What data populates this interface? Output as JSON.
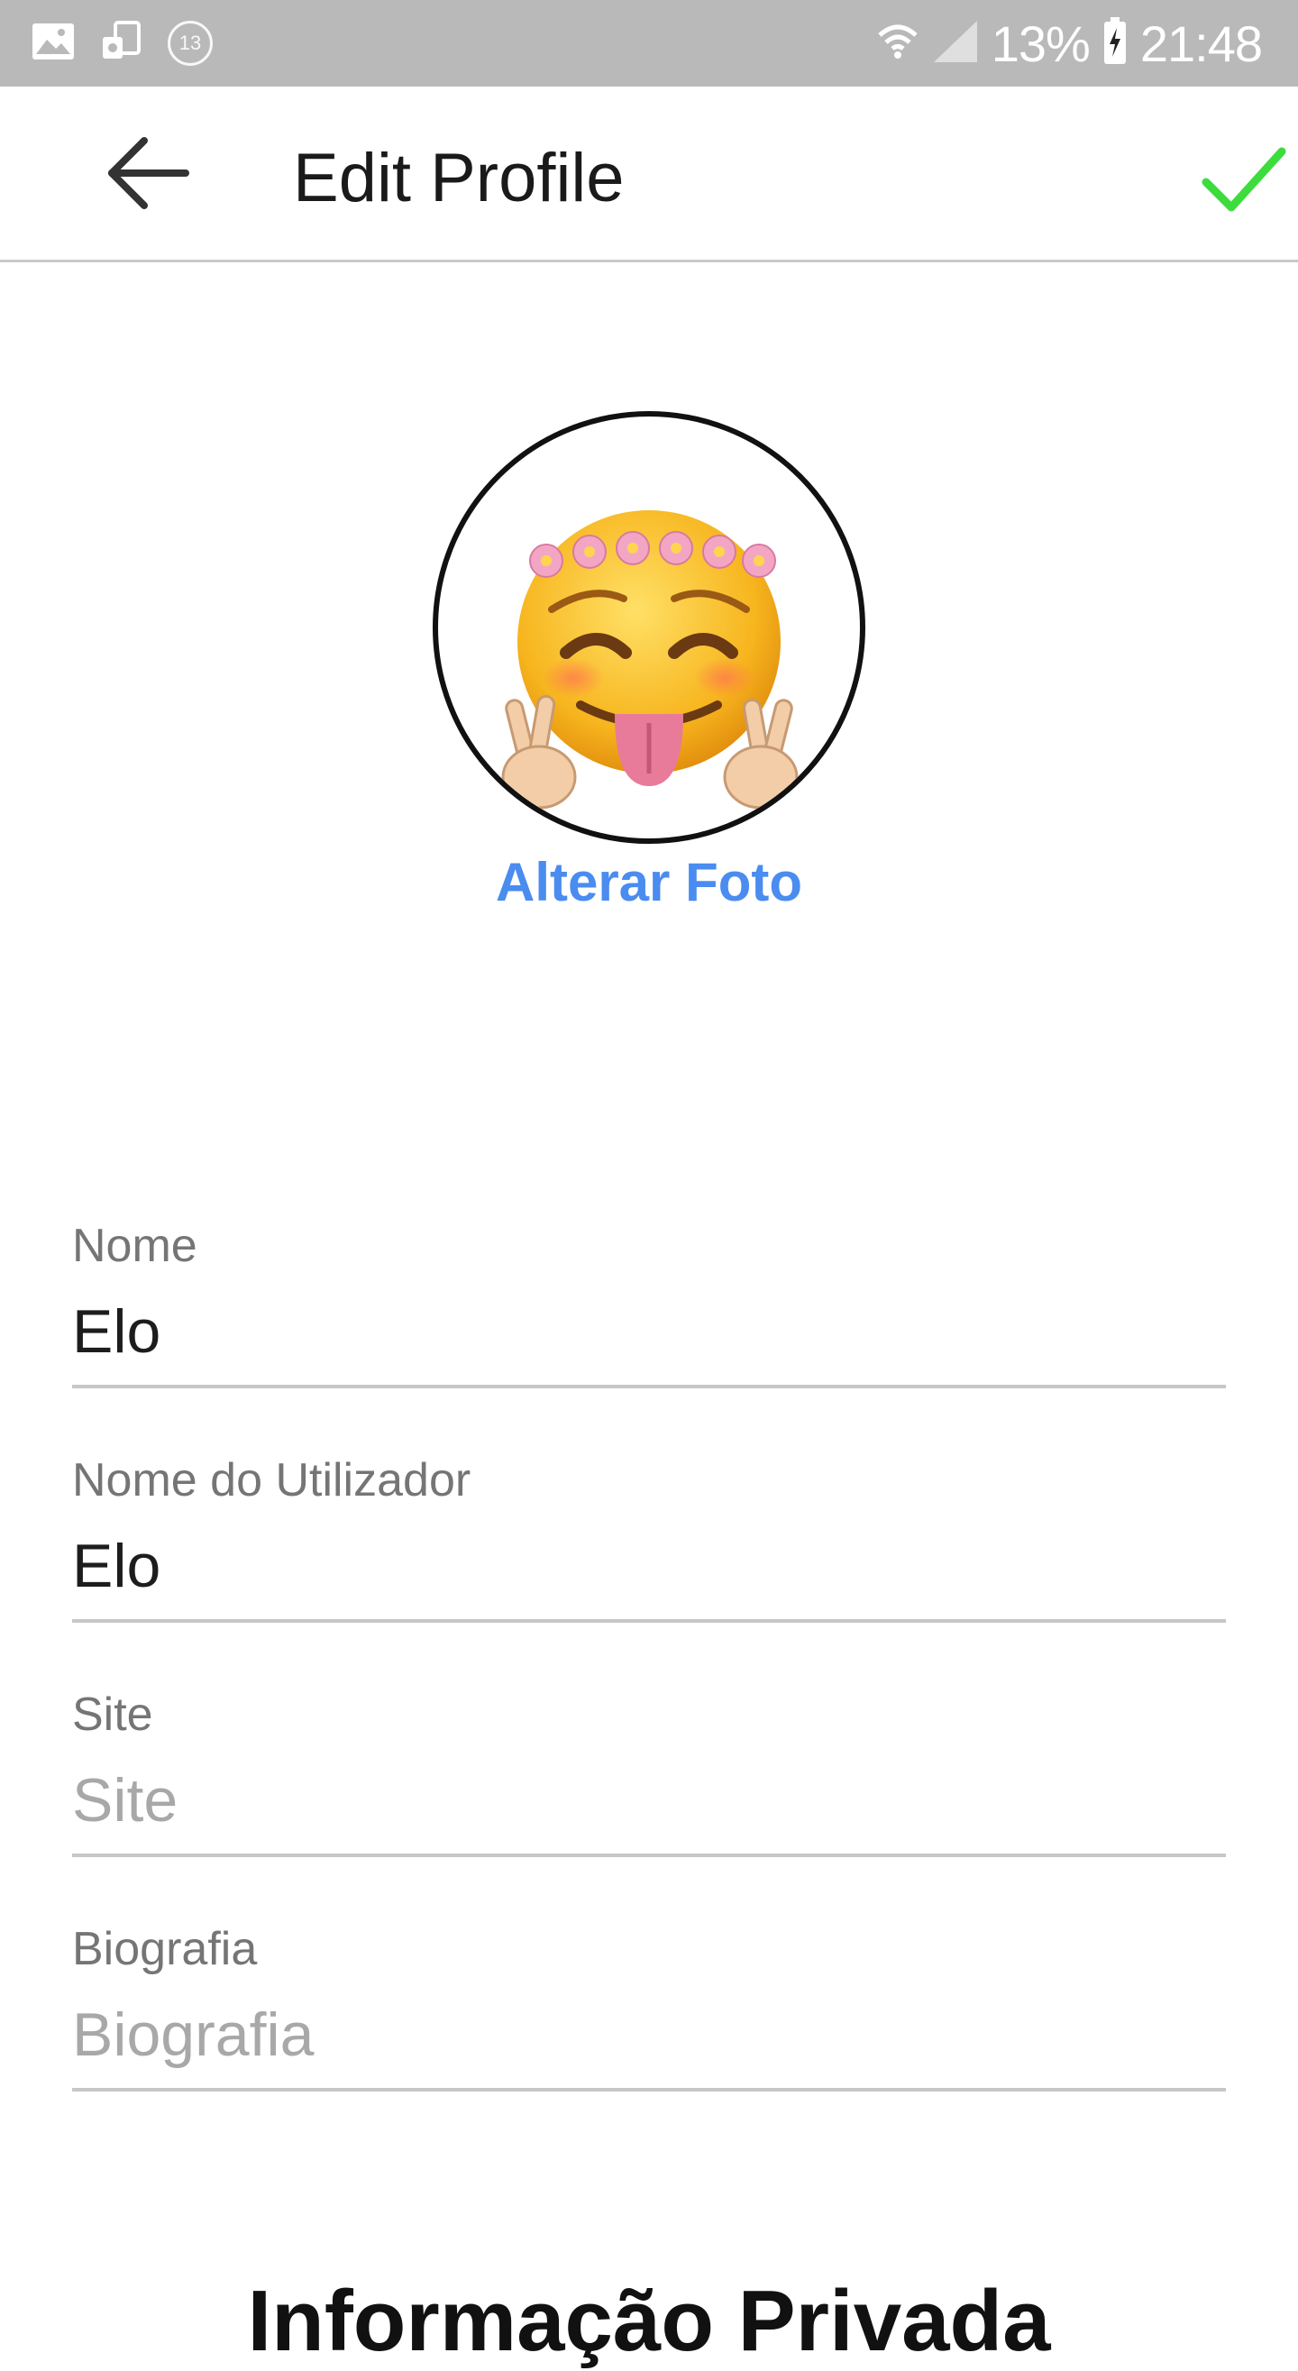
{
  "status_bar": {
    "notification_count": "13",
    "battery": "13%",
    "time": "21:48"
  },
  "toolbar": {
    "title": "Edit Profile",
    "back_icon": "arrow-left-icon",
    "save_icon": "checkmark-icon",
    "save_color": "#3ddc3d"
  },
  "profile": {
    "change_photo_label": "Alterar Foto",
    "link_color": "#4a8cf0"
  },
  "fields": [
    {
      "label": "Nome",
      "value": "Elo",
      "placeholder": ""
    },
    {
      "label": "Nome do Utilizador",
      "value": "Elo",
      "placeholder": ""
    },
    {
      "label": "Site",
      "value": "",
      "placeholder": "Site"
    },
    {
      "label": "Biografia",
      "value": "",
      "placeholder": "Biografia"
    }
  ],
  "section": {
    "heading": "Informação Privada"
  }
}
